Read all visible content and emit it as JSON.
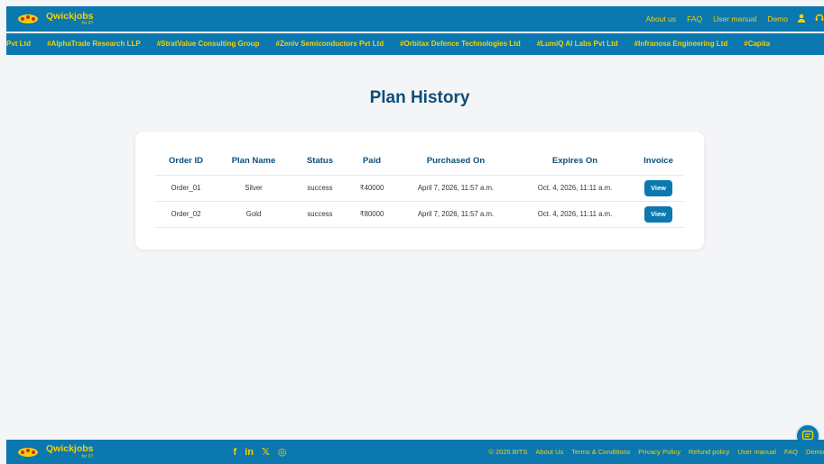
{
  "brand": {
    "name": "Qwickjobs",
    "sub": "for IIT"
  },
  "topnav": {
    "links": [
      "About us",
      "FAQ",
      "User manual",
      "Demo"
    ],
    "user_icon": "user-icon",
    "support_icon": "headset-icon"
  },
  "ticker": {
    "items": [
      "Pvt Ltd",
      "#AlphaTrade Research LLP",
      "#StratValue Consulting Group",
      "#Zeniv Semiconductors Pvt Ltd",
      "#Orbitax Defence Technologies Ltd",
      "#LumiQ AI Labs Pvt Ltd",
      "#Infranosa Engineering Ltd",
      "#Capita"
    ]
  },
  "page": {
    "title": "Plan History"
  },
  "table": {
    "headers": [
      "Order ID",
      "Plan Name",
      "Status",
      "Paid",
      "Purchased On",
      "Expires On",
      "Invoice"
    ],
    "rows": [
      {
        "order_id": "Order_01",
        "plan": "Silver",
        "status": "success",
        "paid": "₹40000",
        "purchased": "April 7, 2026, 11:57 a.m.",
        "expires": "Oct. 4, 2026, 11:11 a.m.",
        "invoice": "View"
      },
      {
        "order_id": "Order_02",
        "plan": "Gold",
        "status": "success",
        "paid": "₹80000",
        "purchased": "April 7, 2026, 11:57 a.m.",
        "expires": "Oct. 4, 2026, 11:11 a.m.",
        "invoice": "View"
      }
    ]
  },
  "footer": {
    "brand": "Qwickjobs",
    "sub": "for IIT",
    "social": {
      "facebook": "f",
      "linkedin": "in",
      "x": "𝕏",
      "instagram": "◎"
    },
    "copyright": "© 2025 BITS",
    "links": [
      "About Us",
      "Terms & Conditions",
      "Privacy Policy",
      "Refund policy",
      "User manual",
      "FAQ",
      "Demo"
    ]
  },
  "colors": {
    "brand_blue": "#0b78b0",
    "accent_yellow": "#f5d000",
    "title_navy": "#0d4e7a"
  }
}
